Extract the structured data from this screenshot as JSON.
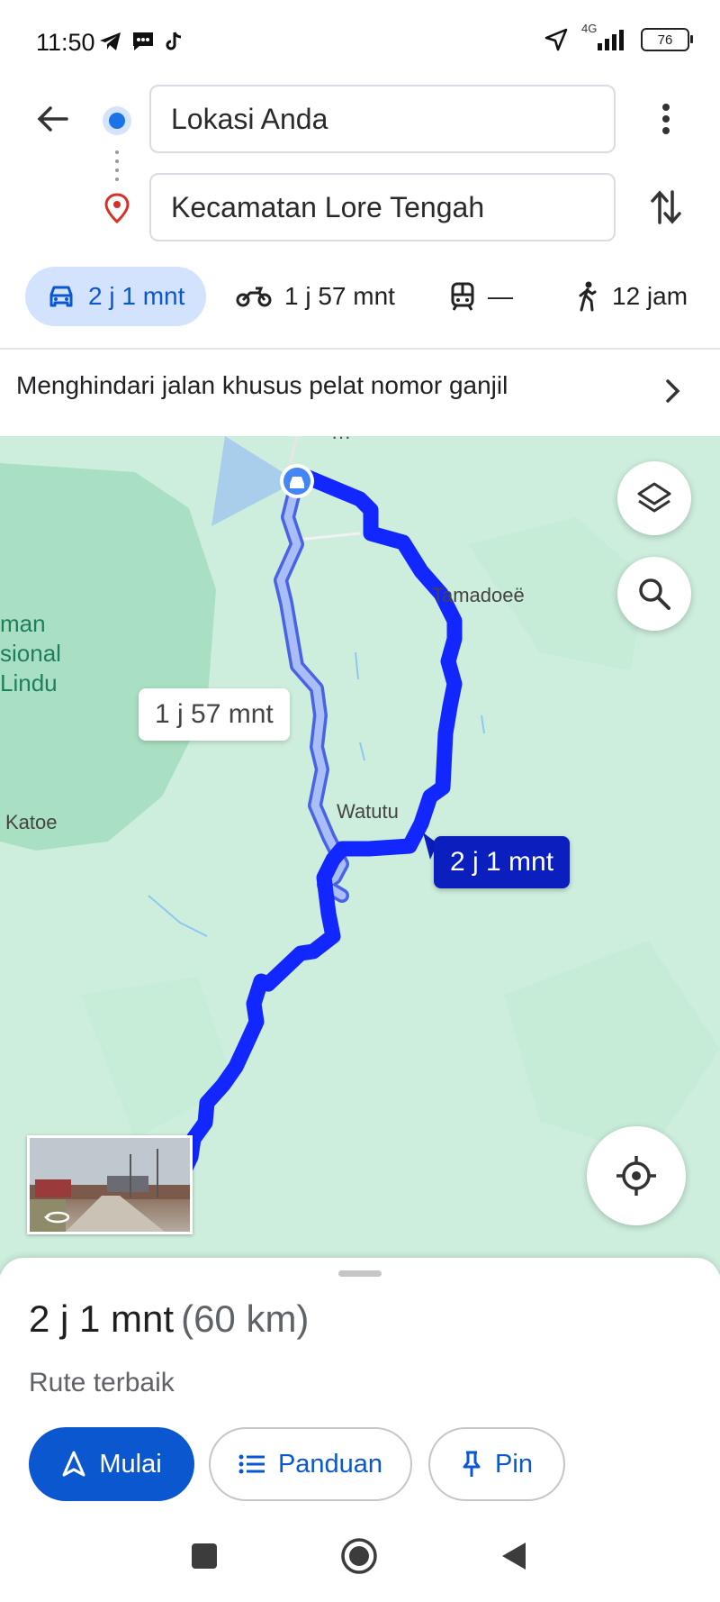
{
  "status_bar": {
    "time": "11:50",
    "left_icons": [
      "telegram-icon",
      "message-icon",
      "tiktok-icon"
    ],
    "network": "4G",
    "battery": "76"
  },
  "route": {
    "origin": "Lokasi Anda",
    "destination": "Kecamatan Lore Tengah"
  },
  "modes": [
    {
      "icon": "car-icon",
      "label": "2 j 1 mnt",
      "active": true
    },
    {
      "icon": "motorcycle-icon",
      "label": "1 j 57 mnt",
      "active": false
    },
    {
      "icon": "transit-icon",
      "label": "—",
      "active": false
    },
    {
      "icon": "walk-icon",
      "label": "12 jam",
      "active": false
    }
  ],
  "notice": "Menghindari jalan khusus pelat nomor ganjil",
  "map": {
    "labels": {
      "tamadoee": "Tamadoeë",
      "watutu": "Watutu",
      "katoe": "Katoe",
      "park_line1": "man",
      "park_line2": "sional",
      "park_line3": "Lindu"
    },
    "alt_route_label": "1 j 57 mnt",
    "main_route_label": "2 j 1 mnt"
  },
  "summary": {
    "duration": "2 j 1 mnt",
    "distance": "(60 km)",
    "subtitle": "Rute terbaik"
  },
  "actions": {
    "start": "Mulai",
    "guide": "Panduan",
    "pin": "Pin"
  },
  "colors": {
    "accent": "#0b57d0",
    "route_main": "#1a2bff",
    "route_alt": "#9fb3f5",
    "map_bg": "#cdeedd",
    "park": "#a9dfc2"
  }
}
